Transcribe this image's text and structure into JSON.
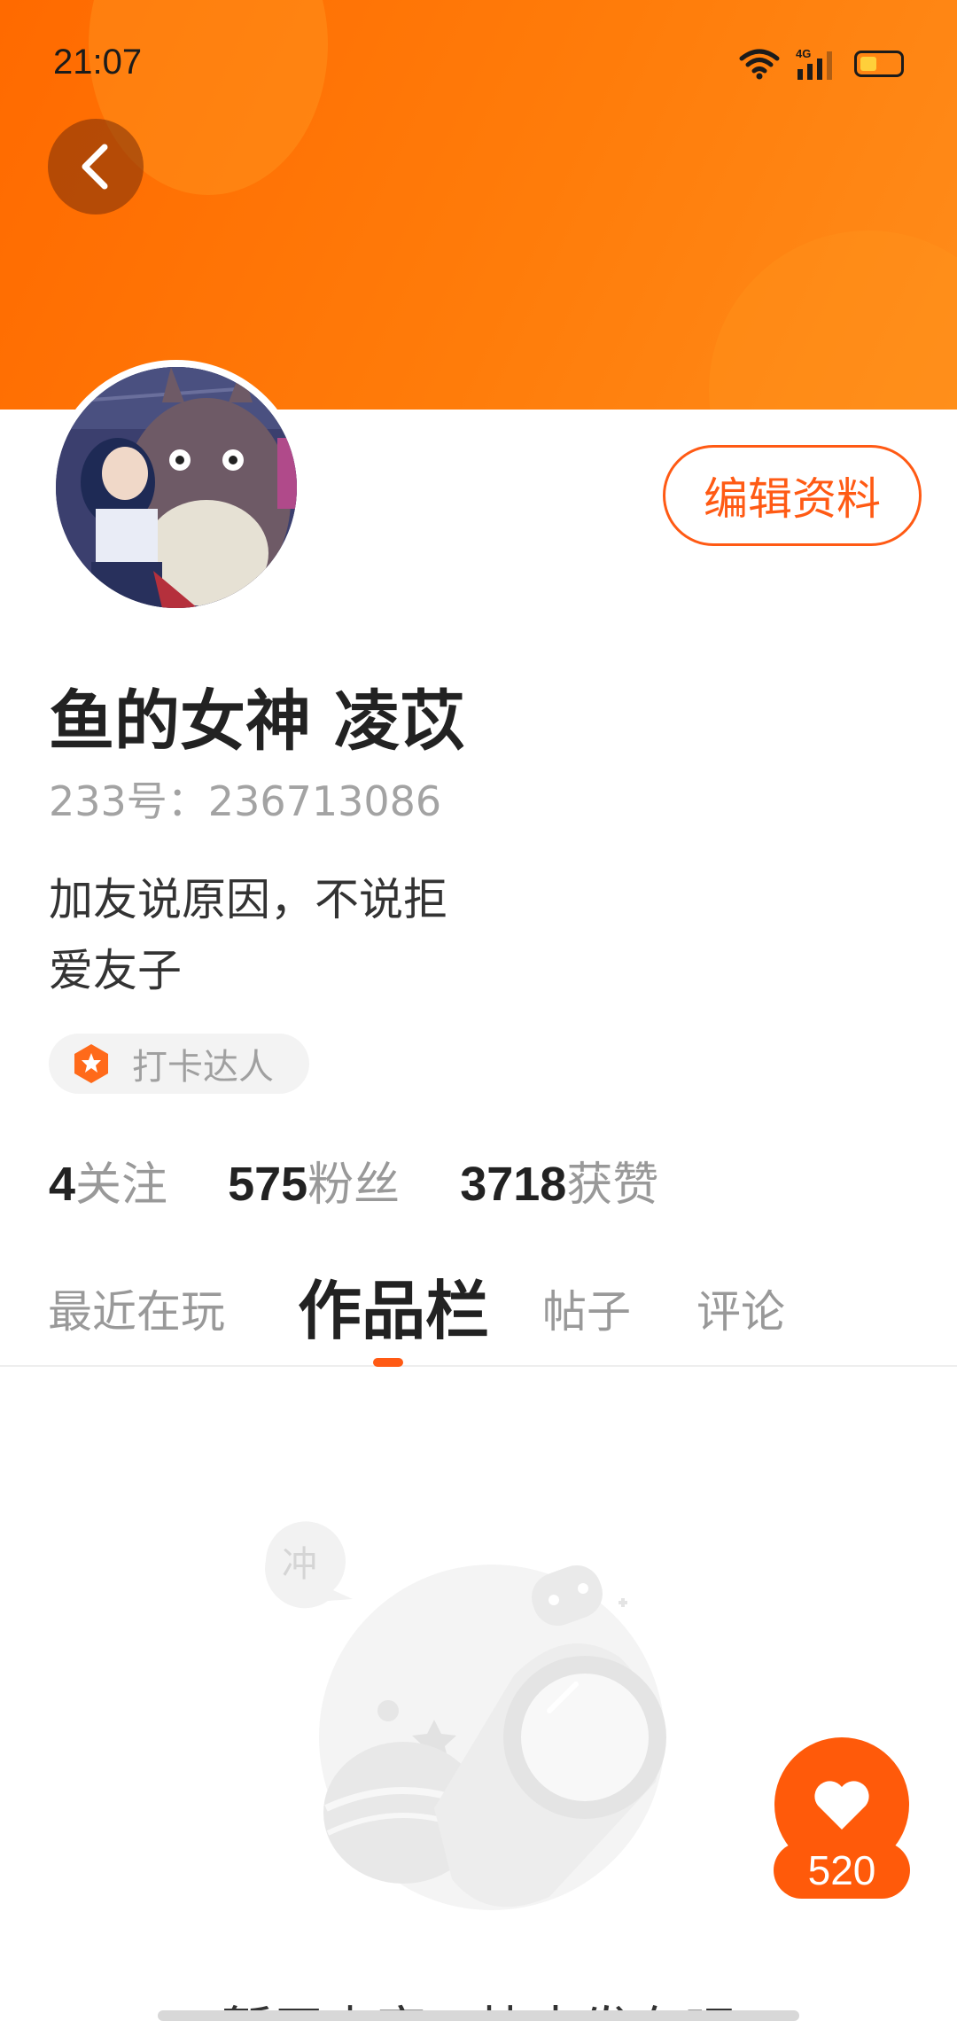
{
  "status_bar": {
    "time": "21:07",
    "network": "4G"
  },
  "profile": {
    "edit_button": "编辑资料",
    "username": "鱼的女神 凌苡",
    "account_id": "233号：236713086",
    "bio_lines": [
      "加友说原因，不说拒",
      "爱友子"
    ],
    "badge": "打卡达人"
  },
  "stats": [
    {
      "num": "4",
      "label": "关注"
    },
    {
      "num": "575",
      "label": "粉丝"
    },
    {
      "num": "3718",
      "label": "获赞"
    }
  ],
  "tabs": [
    {
      "label": "最近在玩",
      "active": false
    },
    {
      "label": "作品栏",
      "active": true
    },
    {
      "label": "帖子",
      "active": false
    },
    {
      "label": "评论",
      "active": false
    }
  ],
  "empty_state": {
    "bubble": "冲",
    "message": "暂无内容，快去发布吧"
  },
  "like_fab": {
    "count": "520"
  },
  "colors": {
    "accent": "#ff5a14",
    "header": "#ff7a00"
  }
}
